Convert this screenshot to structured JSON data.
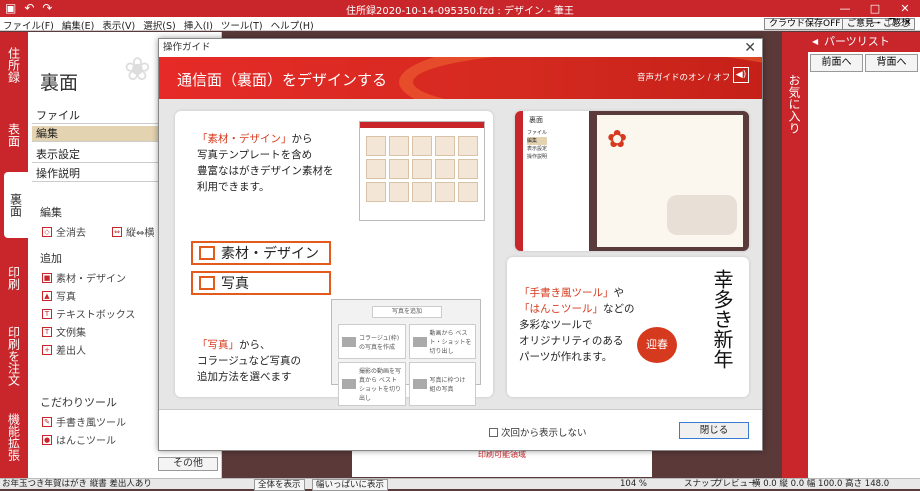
{
  "titlebar": {
    "title": "住所録2020-10-14-095350.fzd : デザイン - 筆王",
    "minimize": "—",
    "maximize": "□",
    "close": "✕"
  },
  "menubar": {
    "items": [
      "ファイル(F)",
      "編集(E)",
      "表示(V)",
      "選択(S)",
      "挿入(I)",
      "ツール(T)",
      "ヘルプ(H)"
    ],
    "cloud_btn": "クラウド保存OFF",
    "feedback_btn": "ご意見・ご感想",
    "win_minimize": "—",
    "win_restore": "❐",
    "win_close": "✕"
  },
  "left_tabs": [
    "住所録",
    "表面",
    "裏面",
    "印刷",
    "印刷を注文",
    "機能拡張"
  ],
  "left_panel": {
    "heading": "裏面",
    "menus": [
      "ファイル",
      "編集",
      "表示設定",
      "操作説明"
    ],
    "edit_section": {
      "title": "編集",
      "clear_all": "全消去",
      "orientation": "縦⇔横"
    },
    "add_section": {
      "title": "追加",
      "items": [
        "素材・デザイン",
        "写真",
        "テキストボックス",
        "文例集",
        "差出人"
      ]
    },
    "kodawari_section": {
      "title": "こだわりツール",
      "items": [
        "手書き風ツール",
        "はんこツール"
      ]
    },
    "other_tab": "その他"
  },
  "canvas": {
    "printable_label": "印刷可能領域"
  },
  "right_panel": {
    "tab_label": "お気に入り",
    "header": "パーツリスト",
    "prev_btn": "前面へ",
    "back_btn": "背面へ"
  },
  "dialog": {
    "title": "操作ガイド",
    "close": "✕",
    "banner_title": "通信面（裏面）をデザインする",
    "voice_toggle": "音声ガイドのオン / オフ",
    "card1": {
      "line1_red": "「素材・デザイン」",
      "line1_rest": "から",
      "line2": "写真テンプレートを含め",
      "line3": "豊富なはがきデザイン素材を",
      "line4": "利用できます。",
      "box1": "素材・デザイン",
      "box2": "写真",
      "line5_red": "「写真」",
      "line5_rest": "から、",
      "line6": "コラージュなど写真の",
      "line7": "追加方法を選べます",
      "photo_options": [
        "写真を追加",
        "コラージュ(枠)の写真を作成",
        "動画から ベスト・ショットを切り出し",
        "撮影の動画を写真から ベストショットを切り出し",
        "写真に枠つけ 組の写真"
      ]
    },
    "card2": {
      "line1_red": "「手書き風ツール」",
      "line1_rest": "や",
      "line2_red": "「はんこツール」",
      "line2_rest": "などの",
      "line3": "多彩なツールで",
      "line4": "オリジナリティのある",
      "line5": "パーツが作れます。",
      "stamp": "迎春",
      "calligraphy": "幸多き新年"
    },
    "mini_panel": {
      "title": "裏面",
      "items": [
        "ファイル",
        "編集",
        "表示設定",
        "操作説明"
      ]
    },
    "dont_show": "次回から表示しない",
    "close_btn": "閉じる"
  },
  "status": {
    "left": "お年玉つき年賀はがき 縦書 差出人あり",
    "fit_all": "全体を表示",
    "fit_width": "幅いっぱいに表示",
    "zoom": "104 %",
    "snap": "スナップ",
    "preview": "プレビュー",
    "coords": "横 0.0 縦 0.0 幅 100.0 高さ 148.0"
  }
}
